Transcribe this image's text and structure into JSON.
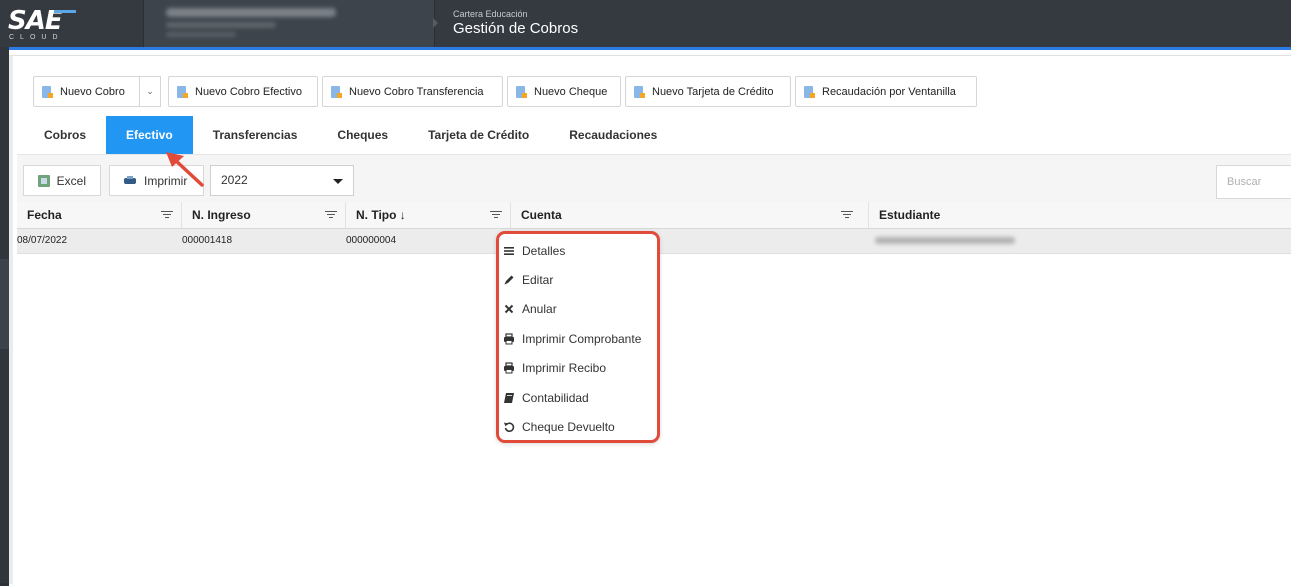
{
  "header": {
    "logo_text": "SAE",
    "logo_sub": "CLOUD",
    "module": "Cartera Educación",
    "title": "Gestión de Cobros"
  },
  "actions": [
    {
      "label": "Nuevo Cobro"
    },
    {
      "label": "Nuevo Cobro Efectivo"
    },
    {
      "label": "Nuevo Cobro Transferencia"
    },
    {
      "label": "Nuevo Cheque"
    },
    {
      "label": "Nuevo Tarjeta de Crédito"
    },
    {
      "label": "Recaudación por Ventanilla"
    }
  ],
  "tabs": [
    {
      "label": "Cobros",
      "active": false
    },
    {
      "label": "Efectivo",
      "active": true
    },
    {
      "label": "Transferencias",
      "active": false
    },
    {
      "label": "Cheques",
      "active": false
    },
    {
      "label": "Tarjeta de Crédito",
      "active": false
    },
    {
      "label": "Recaudaciones",
      "active": false
    }
  ],
  "toolbar": {
    "excel_label": "Excel",
    "print_label": "Imprimir",
    "year": "2022",
    "search_placeholder": "Buscar"
  },
  "columns": [
    "Fecha",
    "N. Ingreso",
    "N. Tipo ↓",
    "Cuenta",
    "Estudiante"
  ],
  "rows": [
    {
      "fecha": "08/07/2022",
      "ingreso": "000001418",
      "tipo": "000000004",
      "cuenta": ""
    }
  ],
  "context_menu": [
    {
      "label": "Detalles",
      "icon": "list-icon"
    },
    {
      "label": "Editar",
      "icon": "pencil-icon"
    },
    {
      "label": "Anular",
      "icon": "x-icon"
    },
    {
      "label": "Imprimir Comprobante",
      "icon": "printer-icon"
    },
    {
      "label": "Imprimir Recibo",
      "icon": "printer-icon"
    },
    {
      "label": "Contabilidad",
      "icon": "book-icon"
    },
    {
      "label": "Cheque Devuelto",
      "icon": "undo-icon"
    }
  ],
  "colors": {
    "accent": "#2196f3",
    "highlight": "#e04b3a",
    "topbar": "#343a40"
  }
}
